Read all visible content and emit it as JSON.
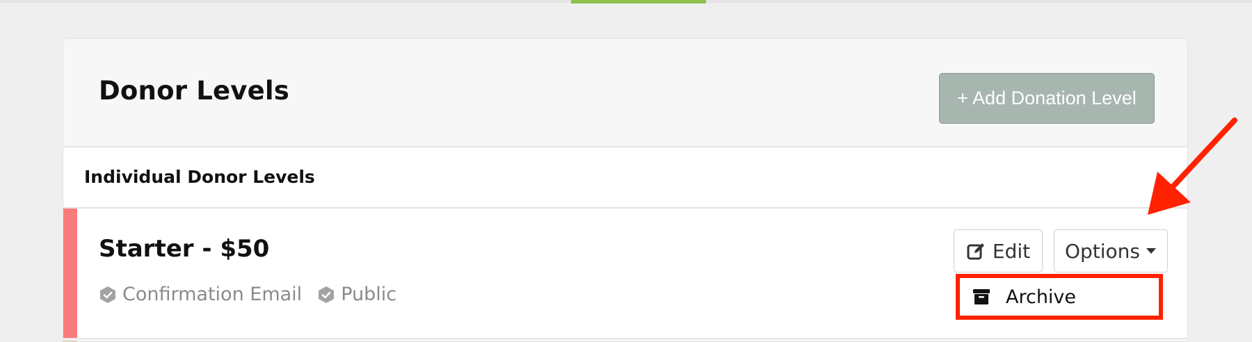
{
  "page": {
    "title": "Donor Levels",
    "add_button_label": "+ Add Donation Level"
  },
  "section": {
    "title": "Individual Donor Levels"
  },
  "levels": [
    {
      "title": "Starter - $50",
      "color": "#f97a7a",
      "tags": [
        {
          "icon": "check-badge-icon",
          "label": "Confirmation Email"
        },
        {
          "icon": "check-badge-icon",
          "label": "Public"
        }
      ],
      "edit_label": "Edit",
      "options_label": "Options",
      "options_menu": [
        {
          "icon": "archive-icon",
          "label": "Archive"
        }
      ]
    }
  ],
  "colors": {
    "accent_tab": "#8dc04a",
    "add_button": "#a8b6b0",
    "annotation_red": "#ff2200"
  },
  "icons": [
    "check-badge-icon",
    "edit-icon",
    "caret-down-icon",
    "archive-icon",
    "annotation-arrow-icon"
  ]
}
